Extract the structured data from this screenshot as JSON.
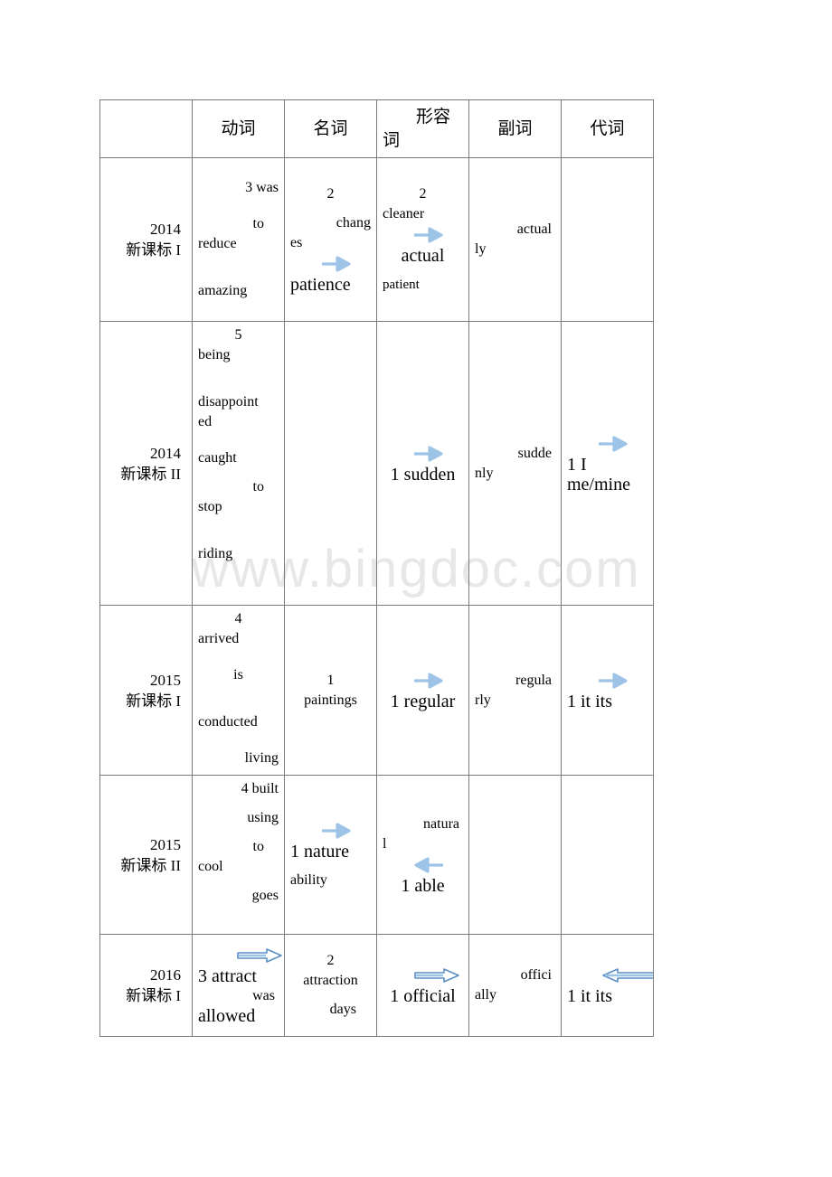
{
  "watermark": "www.bingdoc.com",
  "colors": {
    "arrow_solid": "#9dc3e6",
    "arrow_hollow_stroke": "#5b8fc4",
    "border": "#7b7b7b",
    "watermark": "#e6e7e8"
  },
  "table": {
    "headers": {
      "corner": "",
      "verb": "动词",
      "noun": "名词",
      "adjective_line1": "形容",
      "adjective_line2": "词",
      "adverb": "副词",
      "pronoun": "代词"
    },
    "rows": [
      {
        "year": "2014",
        "standard": "新课标 I",
        "verb": [
          "3 was",
          "to",
          "reduce",
          "amazing"
        ],
        "noun": [
          "2",
          "chang",
          "es",
          "patience"
        ],
        "adjective": [
          "2",
          "cleaner",
          "actual",
          "patient"
        ],
        "adverb": [
          "actual",
          "ly"
        ],
        "pronoun": []
      },
      {
        "year": "2014",
        "standard": "新课标 II",
        "verb": [
          "5",
          "being",
          "disappoint",
          "ed",
          "caught",
          "to",
          "stop",
          "riding"
        ],
        "noun": [],
        "adjective": [
          "1 sudden"
        ],
        "adverb": [
          "sudde",
          "nly"
        ],
        "pronoun": [
          "1  I",
          "me/mine"
        ]
      },
      {
        "year": "2015",
        "standard": "新课标 I",
        "verb": [
          "4",
          "arrived",
          "is",
          "conducted",
          "living"
        ],
        "noun": [
          "1",
          "paintings"
        ],
        "adjective": [
          "1 regular"
        ],
        "adverb": [
          "regula",
          "rly"
        ],
        "pronoun": [
          "1 it its"
        ]
      },
      {
        "year": "2015",
        "standard": "新课标 II",
        "verb": [
          "4 built",
          "using",
          "to",
          "cool",
          "goes"
        ],
        "noun": [
          "1 nature",
          "ability"
        ],
        "adjective": [
          "natura",
          "l",
          "1 able"
        ],
        "adverb": [],
        "pronoun": []
      },
      {
        "year": "2016",
        "standard": "新课标 I",
        "verb": [
          "3 attract",
          "was",
          "allowed"
        ],
        "noun": [
          "2",
          "attraction",
          "days"
        ],
        "adjective": [
          "1 official"
        ],
        "adverb": [
          "offici",
          "ally"
        ],
        "pronoun": [
          "1 it its"
        ]
      }
    ]
  }
}
